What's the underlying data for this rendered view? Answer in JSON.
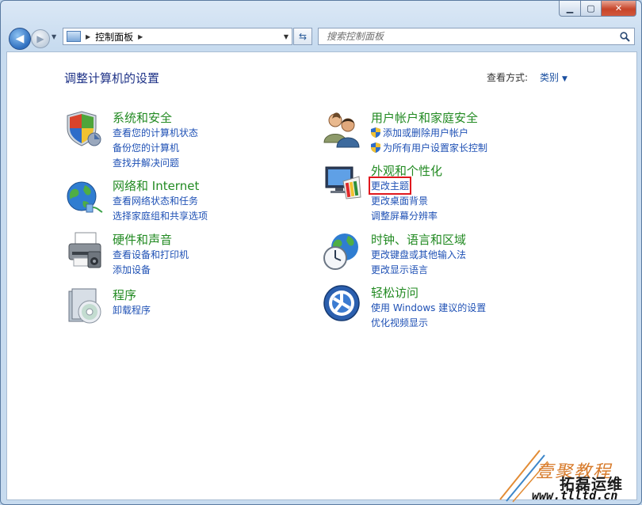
{
  "window": {
    "minimize_label": "▁",
    "maximize_label": "▢",
    "close_label": "✕"
  },
  "address": {
    "crumb": "控制面板"
  },
  "search": {
    "placeholder": "搜索控制面板"
  },
  "header": {
    "title": "调整计算机的设置",
    "view_by_label": "查看方式:",
    "view_by_value": "类别"
  },
  "categories": {
    "system": {
      "title": "系统和安全",
      "icon": "system-security-icon",
      "links": [
        "查看您的计算机状态",
        "备份您的计算机",
        "查找并解决问题"
      ]
    },
    "network": {
      "title": "网络和 Internet",
      "icon": "network-globe-icon",
      "links": [
        "查看网络状态和任务",
        "选择家庭组和共享选项"
      ]
    },
    "hardware": {
      "title": "硬件和声音",
      "icon": "printer-icon",
      "links": [
        "查看设备和打印机",
        "添加设备"
      ]
    },
    "programs": {
      "title": "程序",
      "icon": "programs-disc-icon",
      "links": [
        "卸载程序"
      ]
    },
    "users": {
      "title": "用户帐户和家庭安全",
      "icon": "users-icon",
      "links": [
        "添加或删除用户帐户",
        "为所有用户设置家长控制"
      ]
    },
    "appearance": {
      "title": "外观和个性化",
      "icon": "display-palette-icon",
      "links": [
        "更改主题",
        "更改桌面背景",
        "调整屏幕分辨率"
      ]
    },
    "clock": {
      "title": "时钟、语言和区域",
      "icon": "clock-globe-icon",
      "links": [
        "更改键盘或其他输入法",
        "更改显示语言"
      ]
    },
    "ease": {
      "title": "轻松访问",
      "icon": "ease-of-access-icon",
      "links": [
        "使用 Windows 建议的设置",
        "优化视频显示"
      ]
    }
  },
  "colors": {
    "heading": "#1e3287",
    "category_title": "#228a22",
    "link": "#1f51b5",
    "highlight_box": "#e0181e"
  },
  "watermark": {
    "line1": "壹聚教程",
    "line2": "拓磊运维",
    "line3": "www.tlltd.cn"
  }
}
